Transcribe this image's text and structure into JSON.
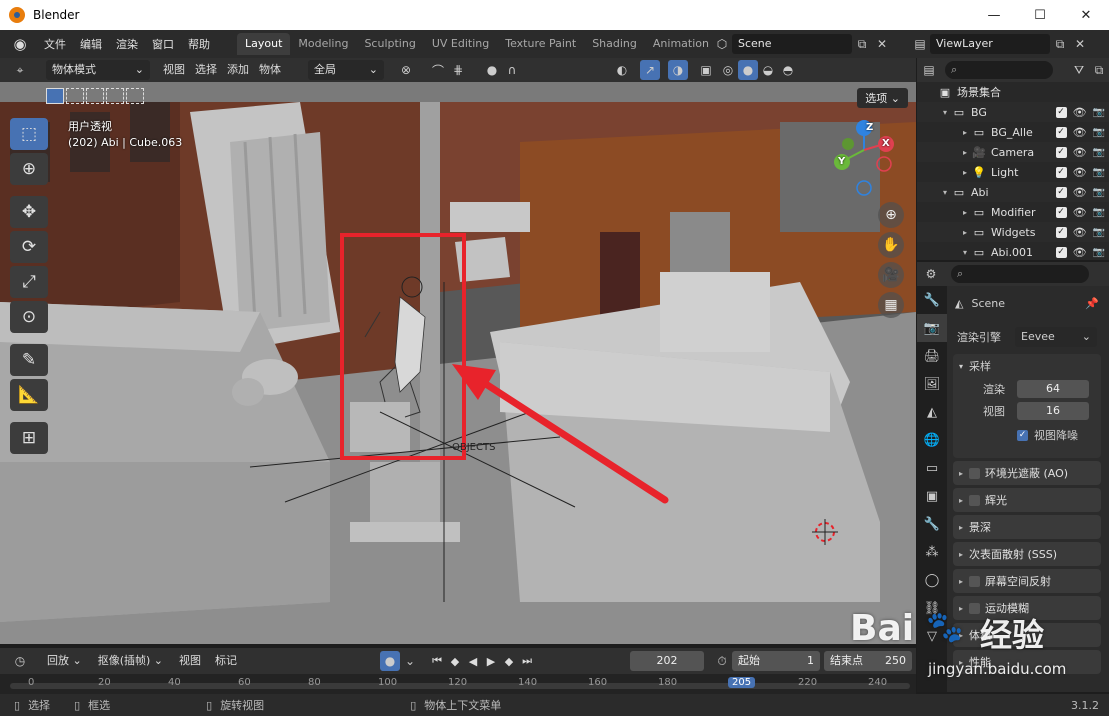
{
  "window": {
    "title": "Blender",
    "minimize": "—",
    "maximize": "☐",
    "close": "✕"
  },
  "topbar": {
    "menus": [
      "文件",
      "编辑",
      "渲染",
      "窗口",
      "帮助"
    ],
    "workspaces": [
      "Layout",
      "Modeling",
      "Sculpting",
      "UV Editing",
      "Texture Paint",
      "Shading",
      "Animation"
    ],
    "active_workspace": "Layout",
    "scene_name": "Scene",
    "view_layer": "ViewLayer"
  },
  "viewport_header": {
    "mode": "物体模式",
    "menus": [
      "视图",
      "选择",
      "添加",
      "物体"
    ],
    "transform_orientation": "全局",
    "select_button": "选项"
  },
  "viewport": {
    "view_name": "用户透视",
    "object_info": "(202) Abi | Cube.063",
    "objects_label": "OBJECTS",
    "gizmo_axes": [
      "X",
      "Y",
      "Z"
    ],
    "accent_red": "#e8232b",
    "selection_blue": "#4772b3"
  },
  "outliner": {
    "root": "场景集合",
    "rows": [
      {
        "name": "BG",
        "indent": 1,
        "icon": "collection-icon",
        "expand": "▾"
      },
      {
        "name": "BG_Alle",
        "indent": 2,
        "icon": "collection-icon",
        "expand": "▸"
      },
      {
        "name": "Camera",
        "indent": 2,
        "icon": "camera-icon",
        "expand": "▸"
      },
      {
        "name": "Light",
        "indent": 2,
        "icon": "light-icon",
        "expand": "▸"
      },
      {
        "name": "Abi",
        "indent": 1,
        "icon": "collection-icon",
        "expand": "▾"
      },
      {
        "name": "Modifier",
        "indent": 2,
        "icon": "collection-icon",
        "expand": "▸"
      },
      {
        "name": "Widgets",
        "indent": 2,
        "icon": "collection-icon",
        "expand": "▸"
      },
      {
        "name": "Abi.001",
        "indent": 2,
        "icon": "collection-icon",
        "expand": "▾"
      }
    ]
  },
  "properties": {
    "context": "Scene",
    "render_engine_label": "渲染引擎",
    "render_engine": "Eevee",
    "sampling_title": "采样",
    "render_label": "渲染",
    "render_samples": "64",
    "viewport_label": "视图",
    "viewport_samples": "16",
    "viewport_denoise": "视图降噪",
    "panels": [
      "环境光遮蔽 (AO)",
      "辉光",
      "景深",
      "次表面散射 (SSS)",
      "屏幕空间反射",
      "运动模糊",
      "体积",
      "性能"
    ]
  },
  "timeline": {
    "playback": "回放",
    "keying": "抠像(插帧)",
    "view": "视图",
    "marker": "标记",
    "current_frame": "202",
    "start_label": "起始",
    "start_frame": "1",
    "end_label": "结束点",
    "end_frame": "250",
    "ruler_ticks": [
      "0",
      "20",
      "40",
      "60",
      "80",
      "100",
      "120",
      "140",
      "160",
      "180",
      "205",
      "220",
      "240"
    ],
    "ruler_current": "205"
  },
  "statusbar": {
    "select": "选择",
    "box_select": "框选",
    "rotate_view": "旋转视图",
    "context_menu": "物体上下文菜单",
    "version": "3.1.2"
  },
  "watermark": {
    "brand": "Bai",
    "brand_cn": "经验",
    "url": "jingyan.baidu.com"
  }
}
